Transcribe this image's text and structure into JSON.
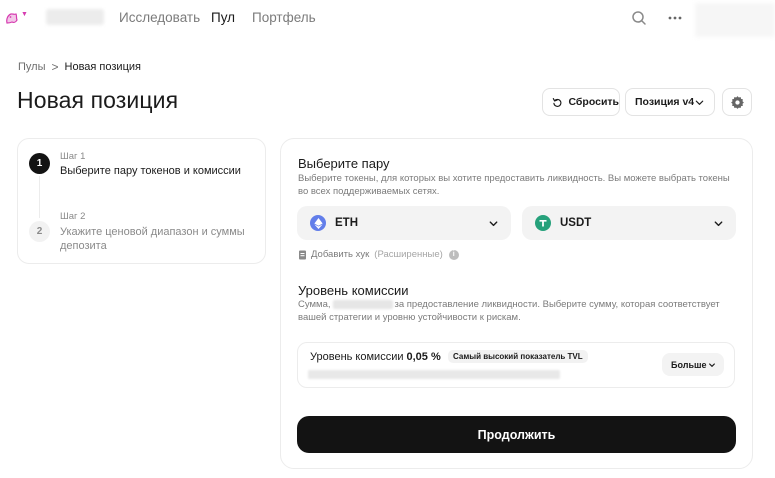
{
  "nav": {
    "links": [
      "Исследовать",
      "Пул",
      "Портфель"
    ],
    "active_link": "Пул"
  },
  "breadcrumb": {
    "parent": "Пулы",
    "separator": ">",
    "current": "Новая позиция"
  },
  "page": {
    "title": "Новая позиция",
    "reset_label": "Сбросить",
    "version_label": "Позиция v4"
  },
  "steps": [
    {
      "number": "1",
      "label": "Шаг 1",
      "title": "Выберите пару токенов и комиссии",
      "active": true
    },
    {
      "number": "2",
      "label": "Шаг 2",
      "title": "Укажите ценовой диапазон и суммы депозита",
      "active": false
    }
  ],
  "pair_section": {
    "title": "Выберите пару",
    "description": "Выберите токены, для которых вы хотите предоставить ликвидность. Вы можете выбрать токены во всех поддерживаемых сетях.",
    "token_a": {
      "symbol": "ETH",
      "icon": "eth-icon",
      "color": "#627eea"
    },
    "token_b": {
      "symbol": "USDT",
      "icon": "usdt-icon",
      "color": "#26a17b"
    },
    "hook_label": "Добавить хук",
    "hook_advanced": "(Расширенные)"
  },
  "fee_section": {
    "title": "Уровень комиссии",
    "description_start": "Сумма,",
    "description_end": "за предоставление ликвидности. Выберите сумму, которая соответствует вашей стратегии и уровню устойчивости к рискам.",
    "fee_label": "Уровень комиссии",
    "fee_value": "0,05 %",
    "badge": "Самый высокий показатель TVL",
    "more_label": "Больше"
  },
  "continue_label": "Продолжить",
  "colors": {
    "brand": "#d63bb0",
    "primary_button": "#131313"
  }
}
